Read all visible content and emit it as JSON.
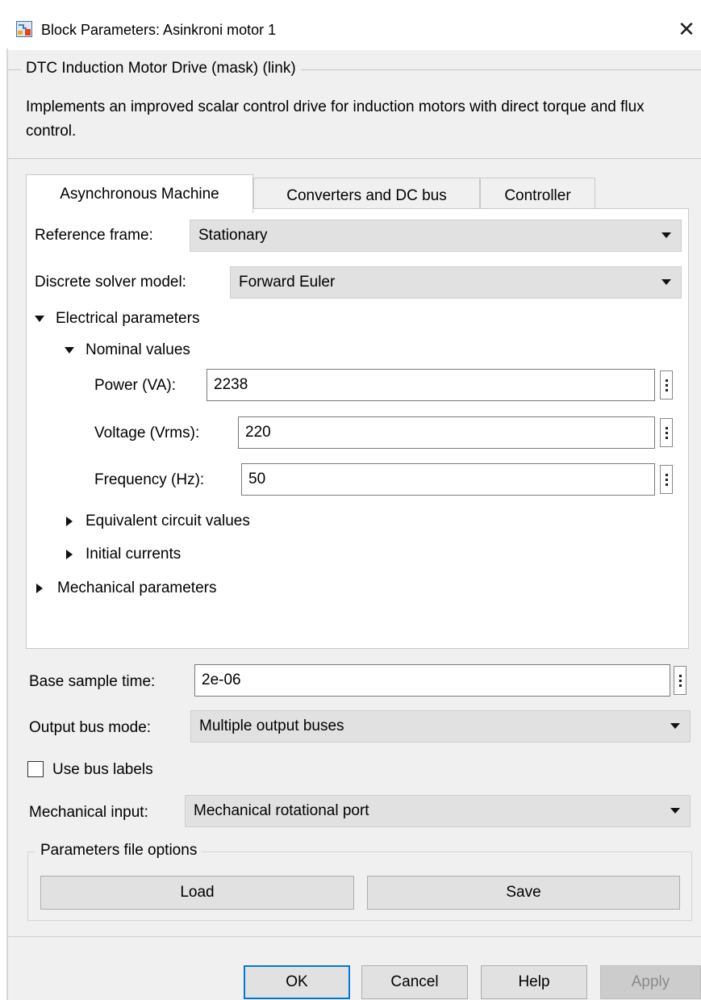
{
  "window": {
    "title": "Block Parameters: Asinkroni motor 1",
    "icon": "simulink-block-icon",
    "close_glyph": "✕"
  },
  "mask": {
    "legend": "DTC Induction Motor Drive (mask) (link)",
    "description": "Implements an improved scalar control drive for induction motors with direct torque and flux control."
  },
  "tabs": [
    {
      "label": "Asynchronous Machine",
      "active": true
    },
    {
      "label": "Converters and DC bus",
      "active": false
    },
    {
      "label": "Controller",
      "active": false
    }
  ],
  "machine": {
    "reference_frame": {
      "label": "Reference frame:",
      "value": "Stationary"
    },
    "solver": {
      "label": "Discrete solver model:",
      "value": "Forward Euler"
    },
    "electrical": {
      "label": "Electrical parameters",
      "expanded": true,
      "nominal": {
        "label": "Nominal values",
        "expanded": true,
        "power": {
          "label": "Power (VA):",
          "value": "2238"
        },
        "voltage": {
          "label": "Voltage (Vrms):",
          "value": "220"
        },
        "frequency": {
          "label": "Frequency (Hz):",
          "value": "50"
        }
      },
      "equivalent": {
        "label": "Equivalent circuit values",
        "expanded": false
      },
      "initial": {
        "label": "Initial currents",
        "expanded": false
      }
    },
    "mechanical": {
      "label": "Mechanical parameters",
      "expanded": false
    }
  },
  "base_sample": {
    "label": "Base sample time:",
    "value": "2e-06"
  },
  "output_bus": {
    "label": "Output bus mode:",
    "value": "Multiple output buses"
  },
  "bus_labels": {
    "label": "Use bus labels",
    "checked": false
  },
  "mech_input": {
    "label": "Mechanical input:",
    "value": "Mechanical rotational port"
  },
  "param_file": {
    "legend": "Parameters file options",
    "load": "Load",
    "save": "Save"
  },
  "footer": {
    "ok": "OK",
    "cancel": "Cancel",
    "help": "Help",
    "apply": "Apply"
  },
  "colors": {
    "panel": "#f0f0f0",
    "default_button_border": "#0078d7",
    "disabled_text": "#8a8a8a"
  }
}
